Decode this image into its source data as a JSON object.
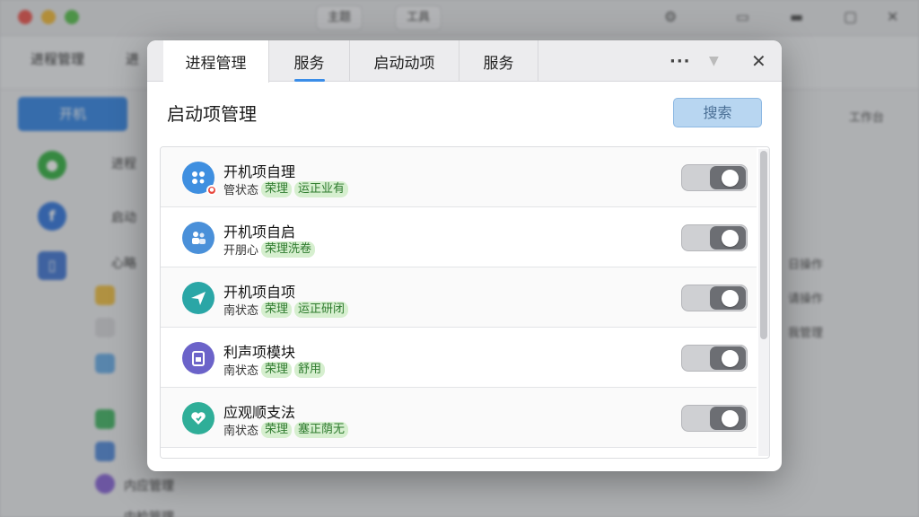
{
  "background": {
    "toolbar_buttons": [
      "主题",
      "工具"
    ],
    "tabs": [
      "进程管理",
      "进"
    ],
    "primary_button": "开机",
    "side_rows": [
      "进程",
      "启动",
      "心略"
    ],
    "right_labels": [
      "工作台",
      "日操作",
      "请操作",
      "我管理"
    ],
    "bottom_rows": [
      "内应管理",
      "内检管理"
    ]
  },
  "dialog": {
    "tabs": [
      {
        "label": "进程管理",
        "active": true
      },
      {
        "label": "服务",
        "active": false
      },
      {
        "label": "启动动项",
        "active": false
      },
      {
        "label": "服务",
        "active": false
      }
    ],
    "more_icon": "ellipsis-icon",
    "collapse_icon": "chevron-down-icon",
    "close_icon": "close-icon",
    "section_title": "启动项管理",
    "search_label": "搜索",
    "items": [
      {
        "name": "开机项自理",
        "status_label": "管状态",
        "tags": [
          "荣理",
          "运正业有"
        ],
        "icon": "cluster-icon",
        "icon_color": "#3f8fe0",
        "has_badge": true,
        "enabled": true
      },
      {
        "name": "开机项自启",
        "status_label": "开朋心",
        "tags": [
          "荣理洗卷"
        ],
        "icon": "users-icon",
        "icon_color": "#4a90d9",
        "has_badge": false,
        "enabled": true
      },
      {
        "name": "开机项自项",
        "status_label": "南状态",
        "tags": [
          "荣理",
          "运正研闭"
        ],
        "icon": "paper-plane-icon",
        "icon_color": "#2aa6a6",
        "has_badge": false,
        "enabled": true
      },
      {
        "name": "利声项模块",
        "status_label": "南状态",
        "tags": [
          "荣理",
          "舒用"
        ],
        "icon": "clipboard-icon",
        "icon_color": "#6b63c9",
        "has_badge": false,
        "enabled": true
      },
      {
        "name": "应观顺支法",
        "status_label": "南状态",
        "tags": [
          "荣理",
          "塞正荫无"
        ],
        "icon": "heart-shield-icon",
        "icon_color": "#2fae98",
        "has_badge": false,
        "enabled": true
      }
    ]
  }
}
